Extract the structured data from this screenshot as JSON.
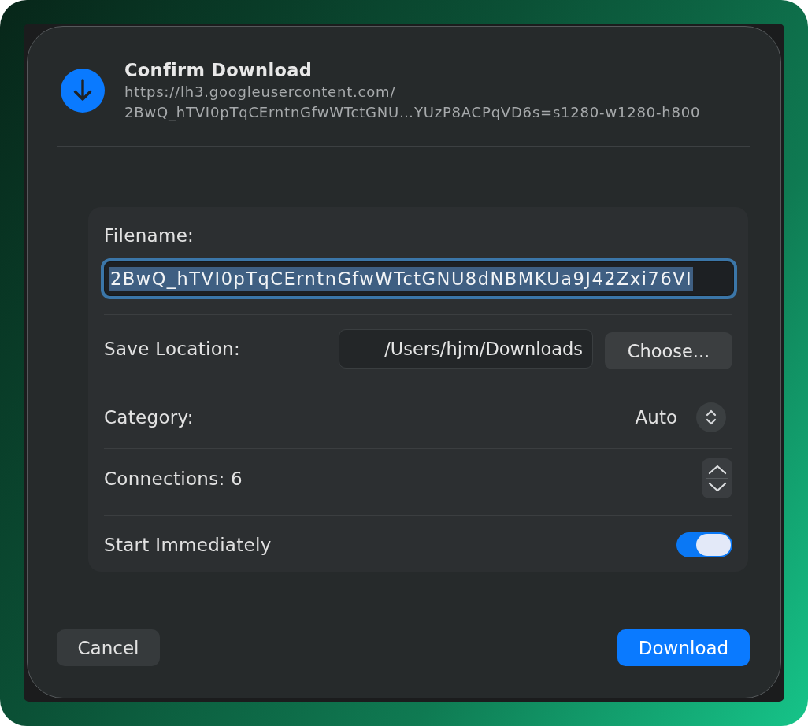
{
  "dialog": {
    "title": "Confirm Download",
    "url_lines": [
      "https://lh3.googleusercontent.com/",
      "2BwQ_hTVI0pTqCErntnGfwWTctGNU…YUzP8ACPqVD6s=s1280-w1280-h800"
    ]
  },
  "form": {
    "rows": [
      {
        "kind": "text_field",
        "label": "Filename:",
        "value": "2BwQ_hTVI0pTqCErntnGfwWTctGNU8dNBMKUa9J42Zxi76VI",
        "focused": true,
        "value_selected": true
      },
      {
        "kind": "path",
        "label": "Save Location:",
        "value": "/Users/hjm/Downloads",
        "button": "Choose..."
      },
      {
        "kind": "popup",
        "label": "Category:",
        "value": "Auto"
      },
      {
        "kind": "stepper",
        "label": "Connections: 6"
      },
      {
        "kind": "switch",
        "label": "Start Immediately",
        "on": true
      }
    ]
  },
  "buttons": [
    {
      "kind": "cancel",
      "label": "Cancel"
    },
    {
      "kind": "confirm",
      "label": "Download"
    }
  ]
}
